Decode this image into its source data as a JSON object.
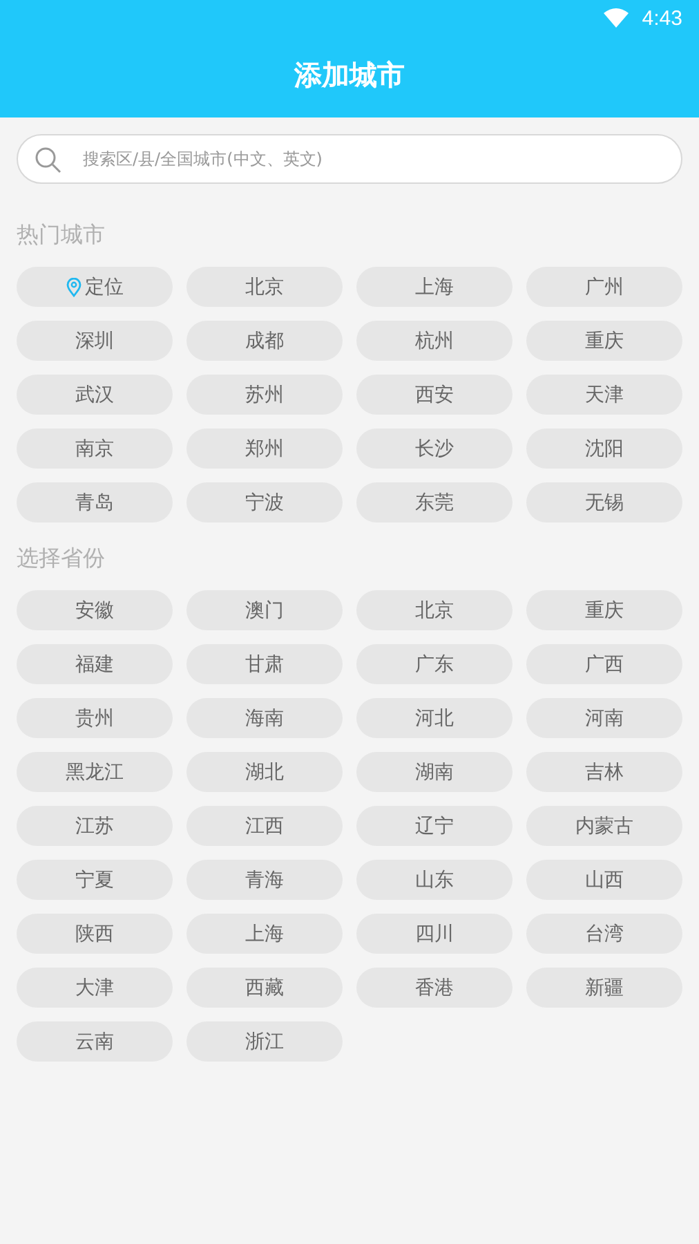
{
  "status_bar": {
    "time": "4:43"
  },
  "header": {
    "title": "添加城市"
  },
  "search": {
    "placeholder": "搜索区/县/全国城市(中文、英文)"
  },
  "sections": [
    {
      "title": "热门城市",
      "items": [
        {
          "label": "定位",
          "kind": "location"
        },
        {
          "label": "北京",
          "kind": "city"
        },
        {
          "label": "上海",
          "kind": "city"
        },
        {
          "label": "广州",
          "kind": "city"
        },
        {
          "label": "深圳",
          "kind": "city"
        },
        {
          "label": "成都",
          "kind": "city"
        },
        {
          "label": "杭州",
          "kind": "city"
        },
        {
          "label": "重庆",
          "kind": "city"
        },
        {
          "label": "武汉",
          "kind": "city"
        },
        {
          "label": "苏州",
          "kind": "city"
        },
        {
          "label": "西安",
          "kind": "city"
        },
        {
          "label": "天津",
          "kind": "city"
        },
        {
          "label": "南京",
          "kind": "city"
        },
        {
          "label": "郑州",
          "kind": "city"
        },
        {
          "label": "长沙",
          "kind": "city"
        },
        {
          "label": "沈阳",
          "kind": "city"
        },
        {
          "label": "青岛",
          "kind": "city"
        },
        {
          "label": "宁波",
          "kind": "city"
        },
        {
          "label": "东莞",
          "kind": "city"
        },
        {
          "label": "无锡",
          "kind": "city"
        }
      ]
    },
    {
      "title": "选择省份",
      "items": [
        {
          "label": "安徽",
          "kind": "city"
        },
        {
          "label": "澳门",
          "kind": "city"
        },
        {
          "label": "北京",
          "kind": "city"
        },
        {
          "label": "重庆",
          "kind": "city"
        },
        {
          "label": "福建",
          "kind": "city"
        },
        {
          "label": "甘肃",
          "kind": "city"
        },
        {
          "label": "广东",
          "kind": "city"
        },
        {
          "label": "广西",
          "kind": "city"
        },
        {
          "label": "贵州",
          "kind": "city"
        },
        {
          "label": "海南",
          "kind": "city"
        },
        {
          "label": "河北",
          "kind": "city"
        },
        {
          "label": "河南",
          "kind": "city"
        },
        {
          "label": "黑龙江",
          "kind": "city"
        },
        {
          "label": "湖北",
          "kind": "city"
        },
        {
          "label": "湖南",
          "kind": "city"
        },
        {
          "label": "吉林",
          "kind": "city"
        },
        {
          "label": "江苏",
          "kind": "city"
        },
        {
          "label": "江西",
          "kind": "city"
        },
        {
          "label": "辽宁",
          "kind": "city"
        },
        {
          "label": "内蒙古",
          "kind": "city"
        },
        {
          "label": "宁夏",
          "kind": "city"
        },
        {
          "label": "青海",
          "kind": "city"
        },
        {
          "label": "山东",
          "kind": "city"
        },
        {
          "label": "山西",
          "kind": "city"
        },
        {
          "label": "陕西",
          "kind": "city"
        },
        {
          "label": "上海",
          "kind": "city"
        },
        {
          "label": "四川",
          "kind": "city"
        },
        {
          "label": "台湾",
          "kind": "city"
        },
        {
          "label": "大津",
          "kind": "city"
        },
        {
          "label": "西藏",
          "kind": "city"
        },
        {
          "label": "香港",
          "kind": "city"
        },
        {
          "label": "新疆",
          "kind": "city"
        },
        {
          "label": "云南",
          "kind": "city"
        },
        {
          "label": "浙江",
          "kind": "city"
        }
      ]
    }
  ]
}
